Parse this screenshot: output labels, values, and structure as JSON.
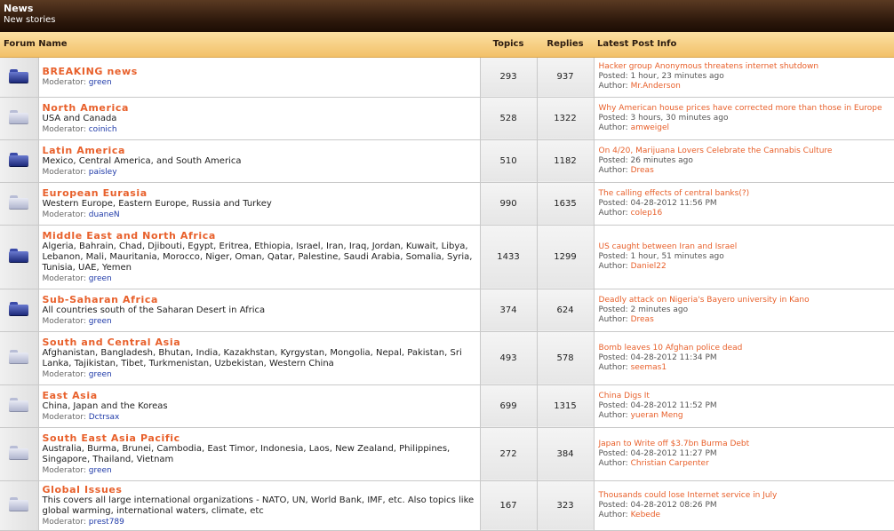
{
  "category": {
    "title": "News",
    "subtitle": "New stories"
  },
  "columns": {
    "forum": "Forum Name",
    "topics": "Topics",
    "replies": "Replies",
    "latest": "Latest Post Info"
  },
  "labels": {
    "moderator": "Moderator:",
    "posted": "Posted:",
    "author": "Author:"
  },
  "forums": [
    {
      "name": "BREAKING news",
      "desc": "",
      "moderator": "green",
      "topics": "293",
      "replies": "937",
      "icon": "dark",
      "post_title": "Hacker group Anonymous threatens internet shutdown",
      "posted": "1 hour, 23 minutes ago",
      "author": "Mr.Anderson"
    },
    {
      "name": "North America",
      "desc": "USA and Canada",
      "moderator": "coinich",
      "topics": "528",
      "replies": "1322",
      "icon": "light",
      "post_title": "Why American house prices have corrected more than those in Europe",
      "posted": "3 hours, 30 minutes ago",
      "author": "amweigel"
    },
    {
      "name": "Latin America",
      "desc": "Mexico, Central America, and South America",
      "moderator": "paisley",
      "topics": "510",
      "replies": "1182",
      "icon": "dark",
      "post_title": "On 4/20, Marijuana Lovers Celebrate the Cannabis Culture",
      "posted": "26 minutes ago",
      "author": "Dreas"
    },
    {
      "name": "European Eurasia",
      "desc": "Western Europe, Eastern Europe, Russia and Turkey",
      "moderator": "duaneN",
      "topics": "990",
      "replies": "1635",
      "icon": "light",
      "post_title": "The calling effects of central banks(?)",
      "posted": "04-28-2012 11:56 PM",
      "author": "colep16"
    },
    {
      "name": "Middle East and North Africa",
      "desc": "Algeria, Bahrain, Chad, Djibouti, Egypt, Eritrea, Ethiopia, Israel, Iran, Iraq, Jordan, Kuwait, Libya, Lebanon, Mali, Mauritania, Morocco, Niger, Oman, Qatar, Palestine, Saudi Arabia, Somalia, Syria, Tunisia, UAE, Yemen",
      "moderator": "green",
      "topics": "1433",
      "replies": "1299",
      "icon": "dark",
      "post_title": "US caught between Iran and Israel",
      "posted": "1 hour, 51 minutes ago",
      "author": "Daniel22"
    },
    {
      "name": "Sub-Saharan Africa",
      "desc": "All countries south of the Saharan Desert in Africa",
      "moderator": "green",
      "topics": "374",
      "replies": "624",
      "icon": "dark",
      "post_title": "Deadly attack on Nigeria's Bayero university in Kano",
      "posted": "2 minutes ago",
      "author": "Dreas"
    },
    {
      "name": "South and Central Asia",
      "desc": "Afghanistan, Bangladesh, Bhutan, India, Kazakhstan, Kyrgystan, Mongolia, Nepal, Pakistan, Sri Lanka, Tajikistan, Tibet, Turkmenistan, Uzbekistan, Western China",
      "moderator": "green",
      "topics": "493",
      "replies": "578",
      "icon": "light",
      "post_title": "Bomb leaves 10 Afghan police dead",
      "posted": "04-28-2012 11:34 PM",
      "author": "seemas1"
    },
    {
      "name": "East Asia",
      "desc": "China, Japan and the Koreas",
      "moderator": "Dctrsax",
      "topics": "699",
      "replies": "1315",
      "icon": "light",
      "post_title": "China Digs It",
      "posted": "04-28-2012 11:52 PM",
      "author": "yueran Meng"
    },
    {
      "name": "South East Asia Pacific",
      "desc": "Australia, Burma, Brunei, Cambodia, East Timor, Indonesia, Laos, New Zealand, Philippines, Singapore, Thailand, Vietnam",
      "moderator": "green",
      "topics": "272",
      "replies": "384",
      "icon": "light",
      "post_title": "Japan to Write off $3.7bn Burma Debt",
      "posted": "04-28-2012 11:27 PM",
      "author": "Christian Carpenter"
    },
    {
      "name": "Global Issues",
      "desc": "This covers all large international organizations - NATO, UN, World Bank, IMF, etc. Also topics like global warming, international waters, climate, etc",
      "moderator": "prest789",
      "topics": "167",
      "replies": "323",
      "icon": "light",
      "post_title": "Thousands could lose Internet service in July",
      "posted": "04-28-2012 08:26 PM",
      "author": "Kebede"
    }
  ]
}
